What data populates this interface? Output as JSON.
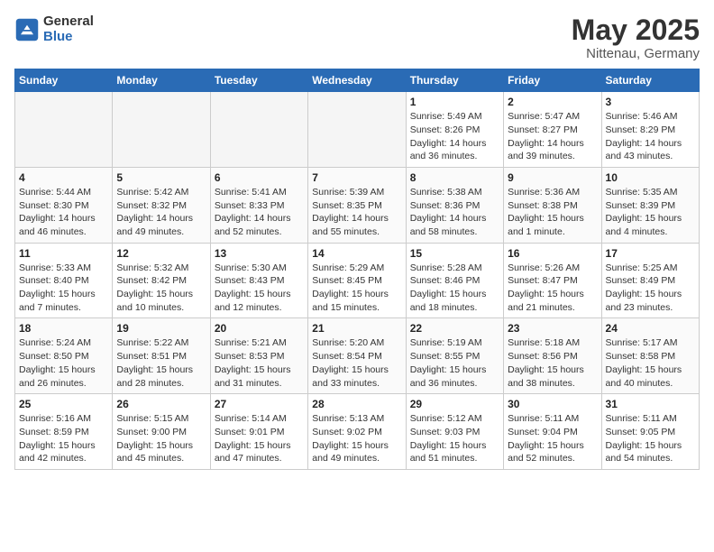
{
  "logo": {
    "general": "General",
    "blue": "Blue"
  },
  "title": "May 2025",
  "subtitle": "Nittenau, Germany",
  "days_of_week": [
    "Sunday",
    "Monday",
    "Tuesday",
    "Wednesday",
    "Thursday",
    "Friday",
    "Saturday"
  ],
  "weeks": [
    [
      {
        "day": "",
        "empty": true
      },
      {
        "day": "",
        "empty": true
      },
      {
        "day": "",
        "empty": true
      },
      {
        "day": "",
        "empty": true
      },
      {
        "day": "1",
        "sunrise": "5:49 AM",
        "sunset": "8:26 PM",
        "daylight": "14 hours and 36 minutes."
      },
      {
        "day": "2",
        "sunrise": "5:47 AM",
        "sunset": "8:27 PM",
        "daylight": "14 hours and 39 minutes."
      },
      {
        "day": "3",
        "sunrise": "5:46 AM",
        "sunset": "8:29 PM",
        "daylight": "14 hours and 43 minutes."
      }
    ],
    [
      {
        "day": "4",
        "sunrise": "5:44 AM",
        "sunset": "8:30 PM",
        "daylight": "14 hours and 46 minutes."
      },
      {
        "day": "5",
        "sunrise": "5:42 AM",
        "sunset": "8:32 PM",
        "daylight": "14 hours and 49 minutes."
      },
      {
        "day": "6",
        "sunrise": "5:41 AM",
        "sunset": "8:33 PM",
        "daylight": "14 hours and 52 minutes."
      },
      {
        "day": "7",
        "sunrise": "5:39 AM",
        "sunset": "8:35 PM",
        "daylight": "14 hours and 55 minutes."
      },
      {
        "day": "8",
        "sunrise": "5:38 AM",
        "sunset": "8:36 PM",
        "daylight": "14 hours and 58 minutes."
      },
      {
        "day": "9",
        "sunrise": "5:36 AM",
        "sunset": "8:38 PM",
        "daylight": "15 hours and 1 minute."
      },
      {
        "day": "10",
        "sunrise": "5:35 AM",
        "sunset": "8:39 PM",
        "daylight": "15 hours and 4 minutes."
      }
    ],
    [
      {
        "day": "11",
        "sunrise": "5:33 AM",
        "sunset": "8:40 PM",
        "daylight": "15 hours and 7 minutes."
      },
      {
        "day": "12",
        "sunrise": "5:32 AM",
        "sunset": "8:42 PM",
        "daylight": "15 hours and 10 minutes."
      },
      {
        "day": "13",
        "sunrise": "5:30 AM",
        "sunset": "8:43 PM",
        "daylight": "15 hours and 12 minutes."
      },
      {
        "day": "14",
        "sunrise": "5:29 AM",
        "sunset": "8:45 PM",
        "daylight": "15 hours and 15 minutes."
      },
      {
        "day": "15",
        "sunrise": "5:28 AM",
        "sunset": "8:46 PM",
        "daylight": "15 hours and 18 minutes."
      },
      {
        "day": "16",
        "sunrise": "5:26 AM",
        "sunset": "8:47 PM",
        "daylight": "15 hours and 21 minutes."
      },
      {
        "day": "17",
        "sunrise": "5:25 AM",
        "sunset": "8:49 PM",
        "daylight": "15 hours and 23 minutes."
      }
    ],
    [
      {
        "day": "18",
        "sunrise": "5:24 AM",
        "sunset": "8:50 PM",
        "daylight": "15 hours and 26 minutes."
      },
      {
        "day": "19",
        "sunrise": "5:22 AM",
        "sunset": "8:51 PM",
        "daylight": "15 hours and 28 minutes."
      },
      {
        "day": "20",
        "sunrise": "5:21 AM",
        "sunset": "8:53 PM",
        "daylight": "15 hours and 31 minutes."
      },
      {
        "day": "21",
        "sunrise": "5:20 AM",
        "sunset": "8:54 PM",
        "daylight": "15 hours and 33 minutes."
      },
      {
        "day": "22",
        "sunrise": "5:19 AM",
        "sunset": "8:55 PM",
        "daylight": "15 hours and 36 minutes."
      },
      {
        "day": "23",
        "sunrise": "5:18 AM",
        "sunset": "8:56 PM",
        "daylight": "15 hours and 38 minutes."
      },
      {
        "day": "24",
        "sunrise": "5:17 AM",
        "sunset": "8:58 PM",
        "daylight": "15 hours and 40 minutes."
      }
    ],
    [
      {
        "day": "25",
        "sunrise": "5:16 AM",
        "sunset": "8:59 PM",
        "daylight": "15 hours and 42 minutes."
      },
      {
        "day": "26",
        "sunrise": "5:15 AM",
        "sunset": "9:00 PM",
        "daylight": "15 hours and 45 minutes."
      },
      {
        "day": "27",
        "sunrise": "5:14 AM",
        "sunset": "9:01 PM",
        "daylight": "15 hours and 47 minutes."
      },
      {
        "day": "28",
        "sunrise": "5:13 AM",
        "sunset": "9:02 PM",
        "daylight": "15 hours and 49 minutes."
      },
      {
        "day": "29",
        "sunrise": "5:12 AM",
        "sunset": "9:03 PM",
        "daylight": "15 hours and 51 minutes."
      },
      {
        "day": "30",
        "sunrise": "5:11 AM",
        "sunset": "9:04 PM",
        "daylight": "15 hours and 52 minutes."
      },
      {
        "day": "31",
        "sunrise": "5:11 AM",
        "sunset": "9:05 PM",
        "daylight": "15 hours and 54 minutes."
      }
    ]
  ]
}
